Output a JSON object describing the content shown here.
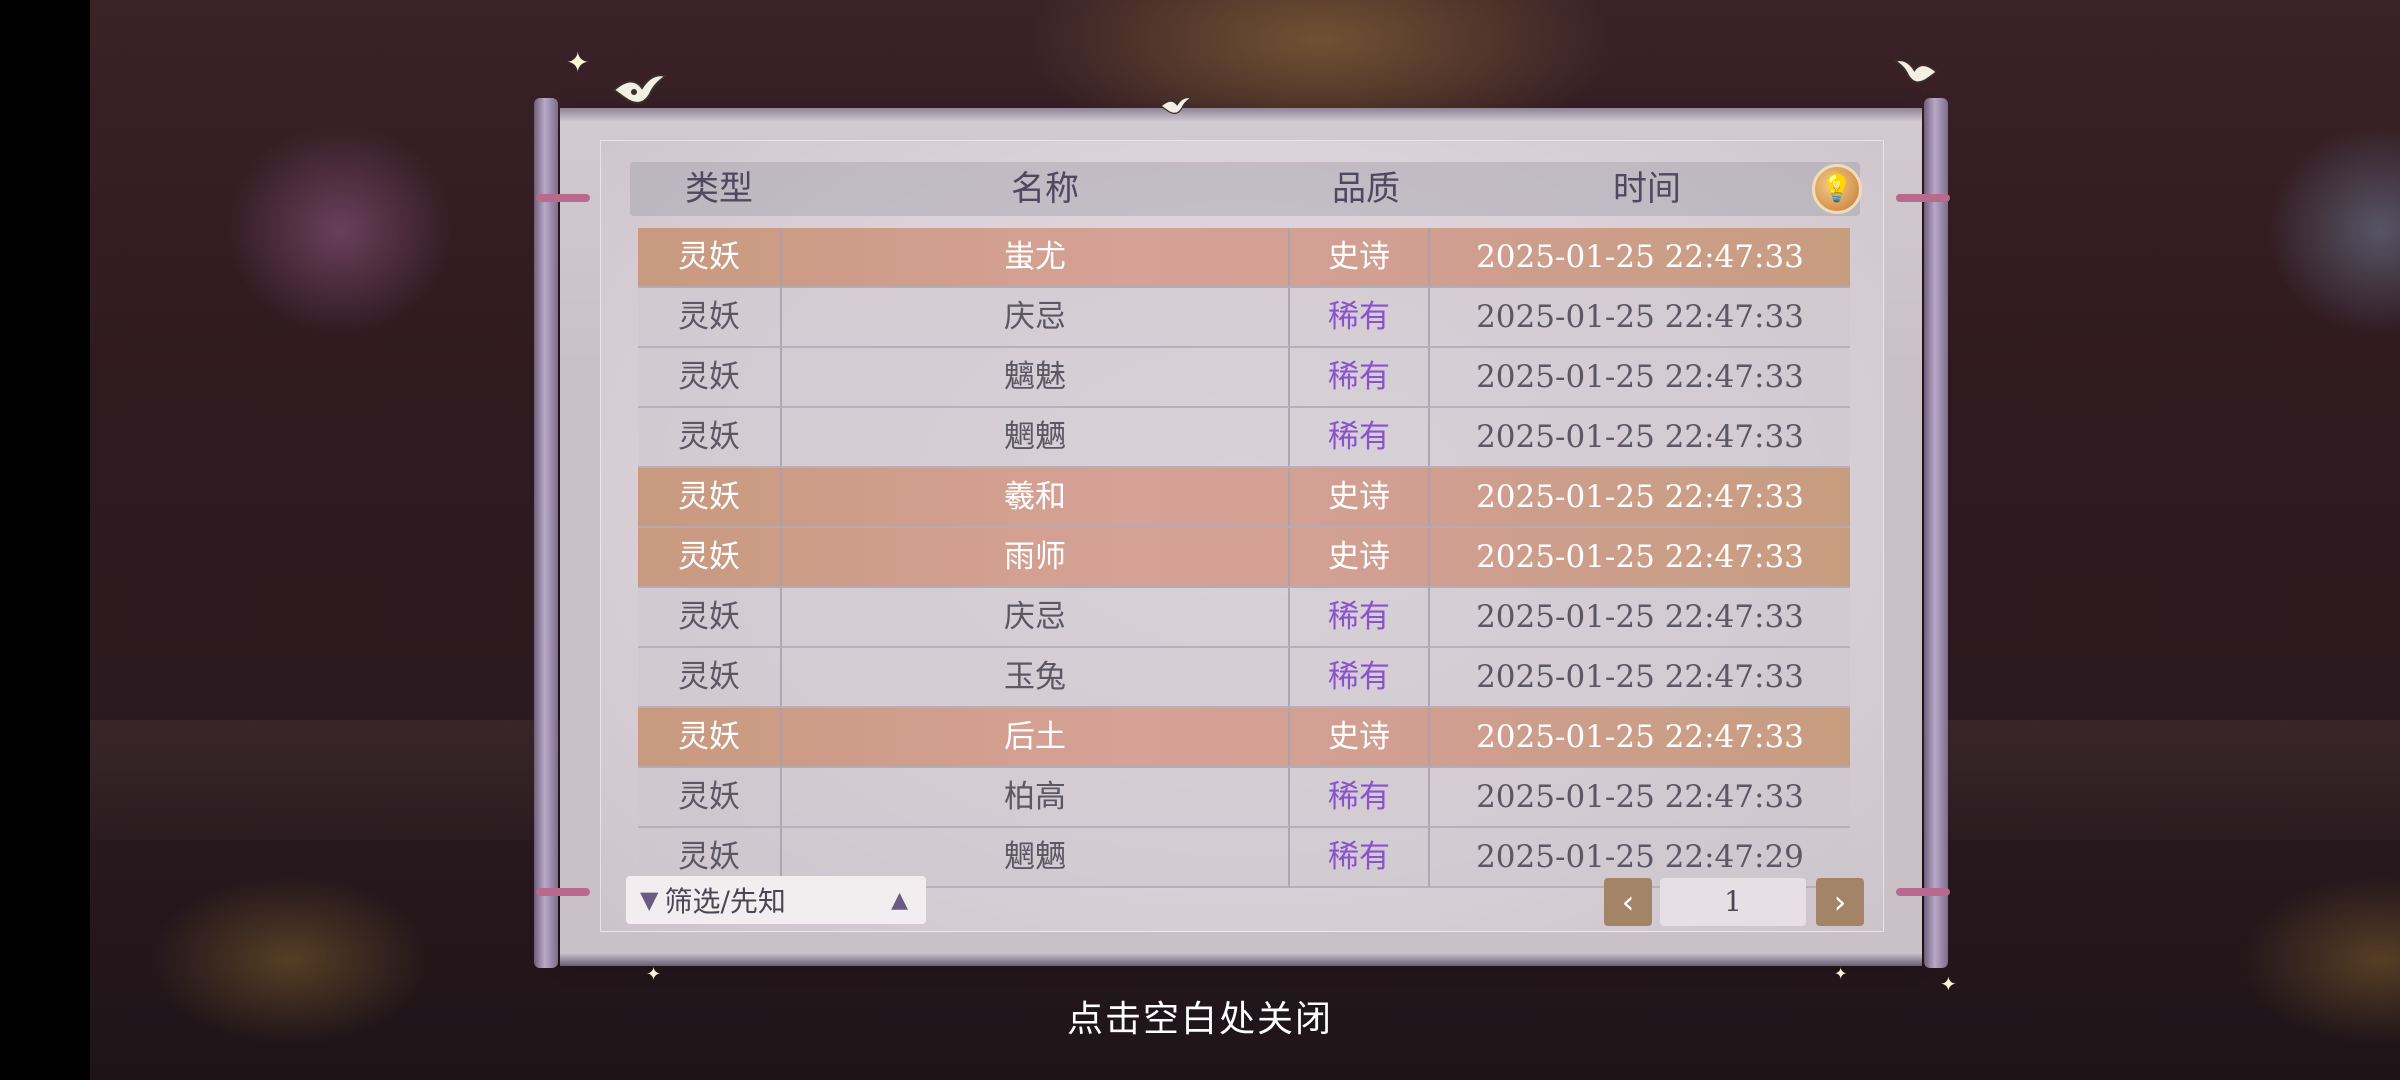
{
  "header": {
    "col_type": "类型",
    "col_name": "名称",
    "col_quality": "品质",
    "col_time": "时间",
    "tip_icon": "lightbulb-icon"
  },
  "rows": [
    {
      "type": "灵妖",
      "name": "蚩尤",
      "quality": "史诗",
      "time": "2025-01-25  22:47:33",
      "tier": "epic"
    },
    {
      "type": "灵妖",
      "name": "庆忌",
      "quality": "稀有",
      "time": "2025-01-25  22:47:33",
      "tier": "rare"
    },
    {
      "type": "灵妖",
      "name": "魑魅",
      "quality": "稀有",
      "time": "2025-01-25  22:47:33",
      "tier": "rare"
    },
    {
      "type": "灵妖",
      "name": "魍魉",
      "quality": "稀有",
      "time": "2025-01-25  22:47:33",
      "tier": "rare"
    },
    {
      "type": "灵妖",
      "name": "羲和",
      "quality": "史诗",
      "time": "2025-01-25  22:47:33",
      "tier": "epic"
    },
    {
      "type": "灵妖",
      "name": "雨师",
      "quality": "史诗",
      "time": "2025-01-25  22:47:33",
      "tier": "epic"
    },
    {
      "type": "灵妖",
      "name": "庆忌",
      "quality": "稀有",
      "time": "2025-01-25  22:47:33",
      "tier": "rare"
    },
    {
      "type": "灵妖",
      "name": "玉兔",
      "quality": "稀有",
      "time": "2025-01-25  22:47:33",
      "tier": "rare"
    },
    {
      "type": "灵妖",
      "name": "后土",
      "quality": "史诗",
      "time": "2025-01-25  22:47:33",
      "tier": "epic"
    },
    {
      "type": "灵妖",
      "name": "柏高",
      "quality": "稀有",
      "time": "2025-01-25  22:47:33",
      "tier": "rare"
    },
    {
      "type": "灵妖",
      "name": "魍魉",
      "quality": "稀有",
      "time": "2025-01-25  22:47:29",
      "tier": "rare"
    }
  ],
  "filter": {
    "label": "筛选/先知",
    "icon": "filter-icon",
    "caret_icon": "caret-up-icon"
  },
  "pagination": {
    "current_page": "1",
    "prev_glyph": "‹",
    "next_glyph": "›"
  },
  "close_hint": "点击空白处关闭",
  "colors": {
    "epic_row": "#d29f93",
    "rare_text": "#8a52cf",
    "page_button": "#a38466"
  }
}
